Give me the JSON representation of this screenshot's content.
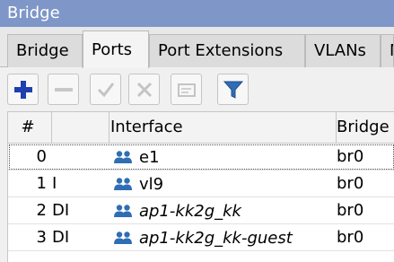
{
  "window": {
    "title": "Bridge"
  },
  "tabs": [
    {
      "label": "Bridge"
    },
    {
      "label": "Ports"
    },
    {
      "label": "Port Extensions"
    },
    {
      "label": "VLANs"
    },
    {
      "label": "M"
    }
  ],
  "toolbar": {
    "buttons": [
      {
        "name": "add",
        "icon": "plus-icon",
        "enabled": true
      },
      {
        "name": "remove",
        "icon": "minus-icon",
        "enabled": false
      },
      {
        "name": "enable",
        "icon": "check-icon",
        "enabled": false
      },
      {
        "name": "disable",
        "icon": "x-icon",
        "enabled": false
      },
      {
        "name": "comment",
        "icon": "comment-icon",
        "enabled": false
      },
      {
        "name": "filter",
        "icon": "filter-icon",
        "enabled": true
      }
    ]
  },
  "table": {
    "columns": [
      "#",
      "",
      "Interface",
      "Bridge"
    ],
    "rows": [
      {
        "num": "0",
        "flags": "",
        "interface": "e1",
        "bridge": "br0",
        "italic": false
      },
      {
        "num": "1",
        "flags": "I",
        "interface": "vl9",
        "bridge": "br0",
        "italic": false
      },
      {
        "num": "2",
        "flags": "DI",
        "interface": "ap1-kk2g_kk",
        "bridge": "br0",
        "italic": true
      },
      {
        "num": "3",
        "flags": "DI",
        "interface": "ap1-kk2g_kk-guest",
        "bridge": "br0",
        "italic": true
      }
    ]
  },
  "colors": {
    "titlebar": "#7f96c8",
    "accent": "#1f5fbf",
    "icon_blue": "#2f6db5"
  }
}
